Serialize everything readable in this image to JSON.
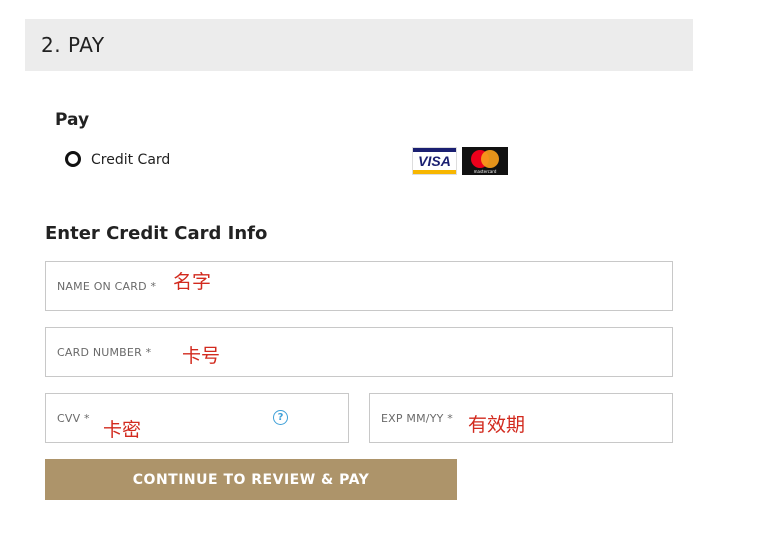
{
  "section": {
    "title": "2. PAY"
  },
  "pay": {
    "heading": "Pay",
    "method_label": "Credit Card",
    "selected": true,
    "card_brands": {
      "visa": "VISA",
      "mastercard": "mastercard"
    }
  },
  "card_info": {
    "heading": "Enter Credit Card Info",
    "name": {
      "label": "NAME ON CARD *",
      "value": "名字"
    },
    "number": {
      "label": "CARD NUMBER *",
      "value": "卡号"
    },
    "cvv": {
      "label": "CVV *",
      "value": "卡密"
    },
    "exp": {
      "label": "EXP MM/YY *",
      "value": "有效期"
    },
    "cvv_help": "?"
  },
  "actions": {
    "continue_label": "CONTINUE TO REVIEW & PAY"
  },
  "colors": {
    "button_bg": "#ad946a",
    "header_bg": "#ececec",
    "annotation_red": "#d22a1e",
    "help_blue": "#3fa0d8"
  }
}
